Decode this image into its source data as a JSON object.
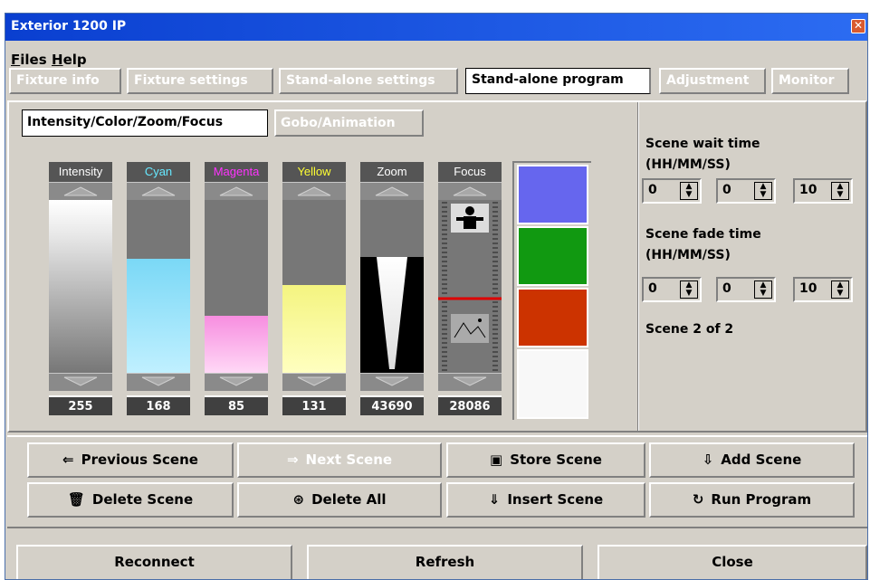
{
  "window": {
    "title": "Exterior 1200 IP",
    "close_glyph": "✕"
  },
  "menu": [
    {
      "letter": "F",
      "rest": "iles"
    },
    {
      "letter": "H",
      "rest": "elp"
    }
  ],
  "tabs": [
    {
      "label": "Fixture info",
      "active": false
    },
    {
      "label": "Fixture settings",
      "active": false
    },
    {
      "label": "Stand-alone settings",
      "active": false
    },
    {
      "label": "Stand-alone program",
      "active": true
    },
    {
      "label": "Adjustment",
      "active": false
    },
    {
      "label": "Monitor",
      "active": false
    }
  ],
  "subtabs": {
    "active": "Intensity/Color/Zoom/Focus",
    "inactive": "Gobo/Animation"
  },
  "channels": [
    {
      "name": "Intensity",
      "label_color": "#ffffff",
      "value": "255",
      "level": 1.0
    },
    {
      "name": "Cyan",
      "label_color": "#66e8ff",
      "value": "168",
      "level": 0.66
    },
    {
      "name": "Magenta",
      "label_color": "#ff33ff",
      "value": "85",
      "level": 0.33
    },
    {
      "name": "Yellow",
      "label_color": "#ffff33",
      "value": "131",
      "level": 0.51
    },
    {
      "name": "Zoom",
      "label_color": "#ffffff",
      "value": "43690",
      "level": 0.67
    },
    {
      "name": "Focus",
      "label_color": "#ffffff",
      "value": "28086",
      "level": 0.43
    }
  ],
  "swatches": [
    "#6666ee",
    "#119911",
    "#cc3300",
    "#f8f8f8"
  ],
  "scene_wait": {
    "label": "Scene wait time",
    "unit": "(HH/MM/SS)",
    "hh": "0",
    "mm": "0",
    "ss": "10"
  },
  "scene_fade": {
    "label": "Scene fade time",
    "unit": "(HH/MM/SS)",
    "hh": "0",
    "mm": "0",
    "ss": "10"
  },
  "scene_status": "Scene 2 of 2",
  "scene_buttons": [
    {
      "label": "Previous Scene",
      "icon": "⇐",
      "icon_name": "arrow-left-icon",
      "disabled": false
    },
    {
      "label": "Next Scene",
      "icon": "⇒",
      "icon_name": "arrow-right-icon",
      "disabled": true
    },
    {
      "label": "Store Scene",
      "icon": "▣",
      "icon_name": "store-icon",
      "disabled": false
    },
    {
      "label": "Add Scene",
      "icon": "⇩",
      "icon_name": "add-icon",
      "disabled": false
    },
    {
      "label": "Delete Scene",
      "icon": "🗑",
      "icon_name": "trash-icon",
      "disabled": false
    },
    {
      "label": "Delete All",
      "icon": "⊛",
      "icon_name": "delete-all-icon",
      "disabled": false
    },
    {
      "label": "Insert Scene",
      "icon": "⇓",
      "icon_name": "insert-icon",
      "disabled": false
    },
    {
      "label": "Run Program",
      "icon": "↻",
      "icon_name": "run-icon",
      "disabled": false
    }
  ],
  "footer_buttons": [
    "Reconnect",
    "Refresh",
    "Close"
  ]
}
